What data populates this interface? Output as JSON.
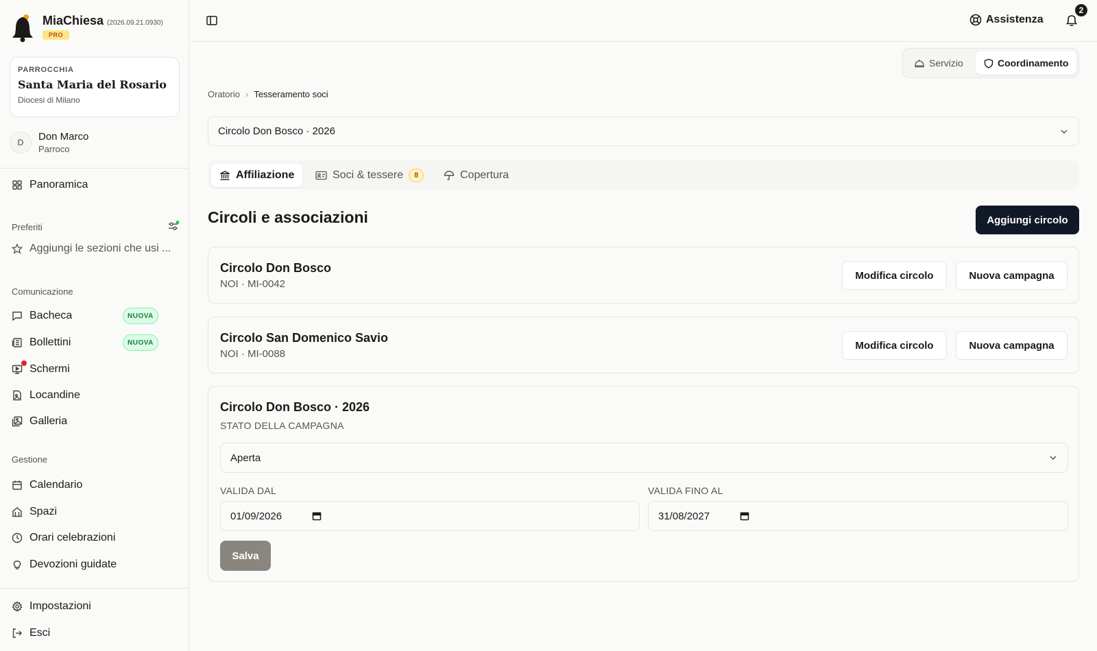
{
  "app": {
    "name": "MiaChiesa",
    "version": "(2026.09.21.0930)",
    "tier": "PRO"
  },
  "parish": {
    "kicker": "PARROCCHIA",
    "name": "Santa Maria del Rosario",
    "diocese": "Diocesi di Milano"
  },
  "user": {
    "initial": "D",
    "name": "Don Marco",
    "role": "Parroco"
  },
  "sidebar": {
    "overview": "Panoramica",
    "favorites": {
      "label": "Preferiti",
      "placeholder": "Aggiungi le sezioni che usi ..."
    },
    "communication": {
      "label": "Comunicazione",
      "items": [
        {
          "label": "Bacheca",
          "badge": "NUOVA"
        },
        {
          "label": "Bollettini",
          "badge": "NUOVA"
        },
        {
          "label": "Schermi"
        },
        {
          "label": "Locandine"
        },
        {
          "label": "Galleria"
        }
      ]
    },
    "management": {
      "label": "Gestione",
      "items": [
        {
          "label": "Calendario"
        },
        {
          "label": "Spazi"
        },
        {
          "label": "Orari celebrazioni"
        },
        {
          "label": "Devozioni guidate"
        }
      ]
    },
    "footer": {
      "settings": "Impostazioni",
      "logout": "Esci"
    }
  },
  "topbar": {
    "assist": "Assistenza",
    "notifications_count": "2"
  },
  "mode": {
    "service": "Servizio",
    "coordination": "Coordinamento",
    "active": "Coordinamento"
  },
  "breadcrumb": {
    "parent": "Oratorio",
    "current": "Tesseramento soci"
  },
  "campaign_select": {
    "value": "Circolo Don Bosco · 2026"
  },
  "tabs": [
    {
      "label": "Affiliazione",
      "active": true
    },
    {
      "label": "Soci & tessere",
      "count": "8"
    },
    {
      "label": "Copertura"
    }
  ],
  "section": {
    "title": "Circoli e associazioni",
    "add_button": "Aggiungi circolo"
  },
  "circles": [
    {
      "name": "Circolo Don Bosco",
      "code": "NOI · MI-0042",
      "edit": "Modifica circolo",
      "new_campaign": "Nuova campagna"
    },
    {
      "name": "Circolo San Domenico Savio",
      "code": "NOI · MI-0088",
      "edit": "Modifica circolo",
      "new_campaign": "Nuova campagna"
    }
  ],
  "campaign": {
    "title": "Circolo Don Bosco · 2026",
    "status_label": "STATO DELLA CAMPAGNA",
    "status_value": "Aperta",
    "valid_from_label": "VALIDA DAL",
    "valid_from": "01/09/2026",
    "valid_to_label": "VALIDA FINO AL",
    "valid_to": "31/08/2027",
    "save": "Salva"
  },
  "colors": {
    "primary": "#111827",
    "accent_amber": "#f59e0b",
    "new_badge": "#15803d",
    "notification_dot": "#dc2626",
    "favorites_dot": "#22c55e"
  }
}
